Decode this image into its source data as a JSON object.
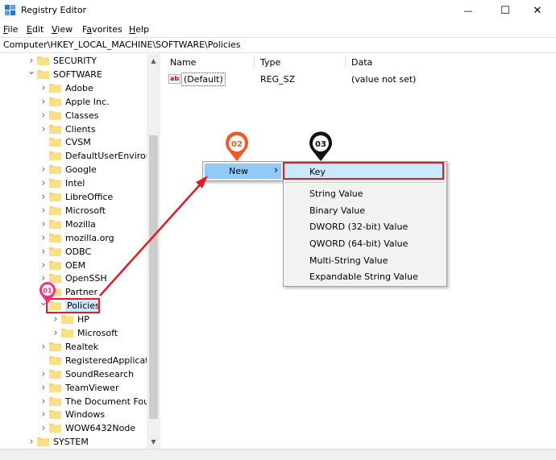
{
  "window": {
    "title": "Registry Editor",
    "controls": {
      "minimize": "—",
      "maximize": "☐",
      "close": "✕"
    }
  },
  "menu": [
    {
      "key": "F",
      "rest": "ile"
    },
    {
      "key": "E",
      "rest": "dit"
    },
    {
      "key": "V",
      "rest": "iew"
    },
    {
      "pre": "F",
      "key": "a",
      "rest": "vorites"
    },
    {
      "key": "H",
      "rest": "elp"
    }
  ],
  "address": "Computer\\HKEY_LOCAL_MACHINE\\SOFTWARE\\Policies",
  "tree": [
    {
      "label": "SECURITY",
      "chevron": "right"
    },
    {
      "label": "SOFTWARE",
      "chevron": "down"
    },
    {
      "label": "Adobe",
      "chevron": "right"
    },
    {
      "label": "Apple Inc.",
      "chevron": "right"
    },
    {
      "label": "Classes",
      "chevron": "right"
    },
    {
      "label": "Clients",
      "chevron": "right"
    },
    {
      "label": "CVSM",
      "chevron": "none"
    },
    {
      "label": "DefaultUserEnvironn",
      "chevron": "none"
    },
    {
      "label": "Google",
      "chevron": "right"
    },
    {
      "label": "Intel",
      "chevron": "right"
    },
    {
      "label": "LibreOffice",
      "chevron": "right"
    },
    {
      "label": "Microsoft",
      "chevron": "right"
    },
    {
      "label": "Mozilla",
      "chevron": "right"
    },
    {
      "label": "mozilla.org",
      "chevron": "right"
    },
    {
      "label": "ODBC",
      "chevron": "right"
    },
    {
      "label": "OEM",
      "chevron": "right"
    },
    {
      "label": "OpenSSH",
      "chevron": "right"
    },
    {
      "label": "Partner",
      "chevron": "right"
    },
    {
      "label": "Policies",
      "chevron": "down",
      "selected": true
    },
    {
      "label": "HP",
      "chevron": "right"
    },
    {
      "label": "Microsoft",
      "chevron": "right"
    },
    {
      "label": "Realtek",
      "chevron": "right"
    },
    {
      "label": "RegisteredApplicatic",
      "chevron": "none"
    },
    {
      "label": "SoundResearch",
      "chevron": "right"
    },
    {
      "label": "TeamViewer",
      "chevron": "right"
    },
    {
      "label": "The Document Foun",
      "chevron": "right"
    },
    {
      "label": "Windows",
      "chevron": "right"
    },
    {
      "label": "WOW6432Node",
      "chevron": "right"
    },
    {
      "label": "SYSTEM",
      "chevron": "right"
    }
  ],
  "list": {
    "columns": [
      "Name",
      "Type",
      "Data"
    ],
    "rows": [
      {
        "icon": "ab",
        "name": "(Default)",
        "type": "REG_SZ",
        "data": "(value not set)"
      }
    ]
  },
  "context_menu": {
    "new_label": "New",
    "arrow": "›"
  },
  "submenu": {
    "items": [
      "Key",
      "String Value",
      "Binary Value",
      "DWORD (32-bit) Value",
      "QWORD (64-bit) Value",
      "Multi-String Value",
      "Expandable String Value"
    ]
  },
  "annotations": {
    "badges": [
      "01",
      "02",
      "03"
    ],
    "colors": {
      "badge1": "#ff2d7a",
      "badge2": "#f15a24",
      "badge3": "#111111",
      "highlight": "#e31b23"
    }
  },
  "colors": {
    "hover_blue": "#91c9f7",
    "selection_blue": "#cce8ff",
    "folder": "#f7d56b"
  }
}
